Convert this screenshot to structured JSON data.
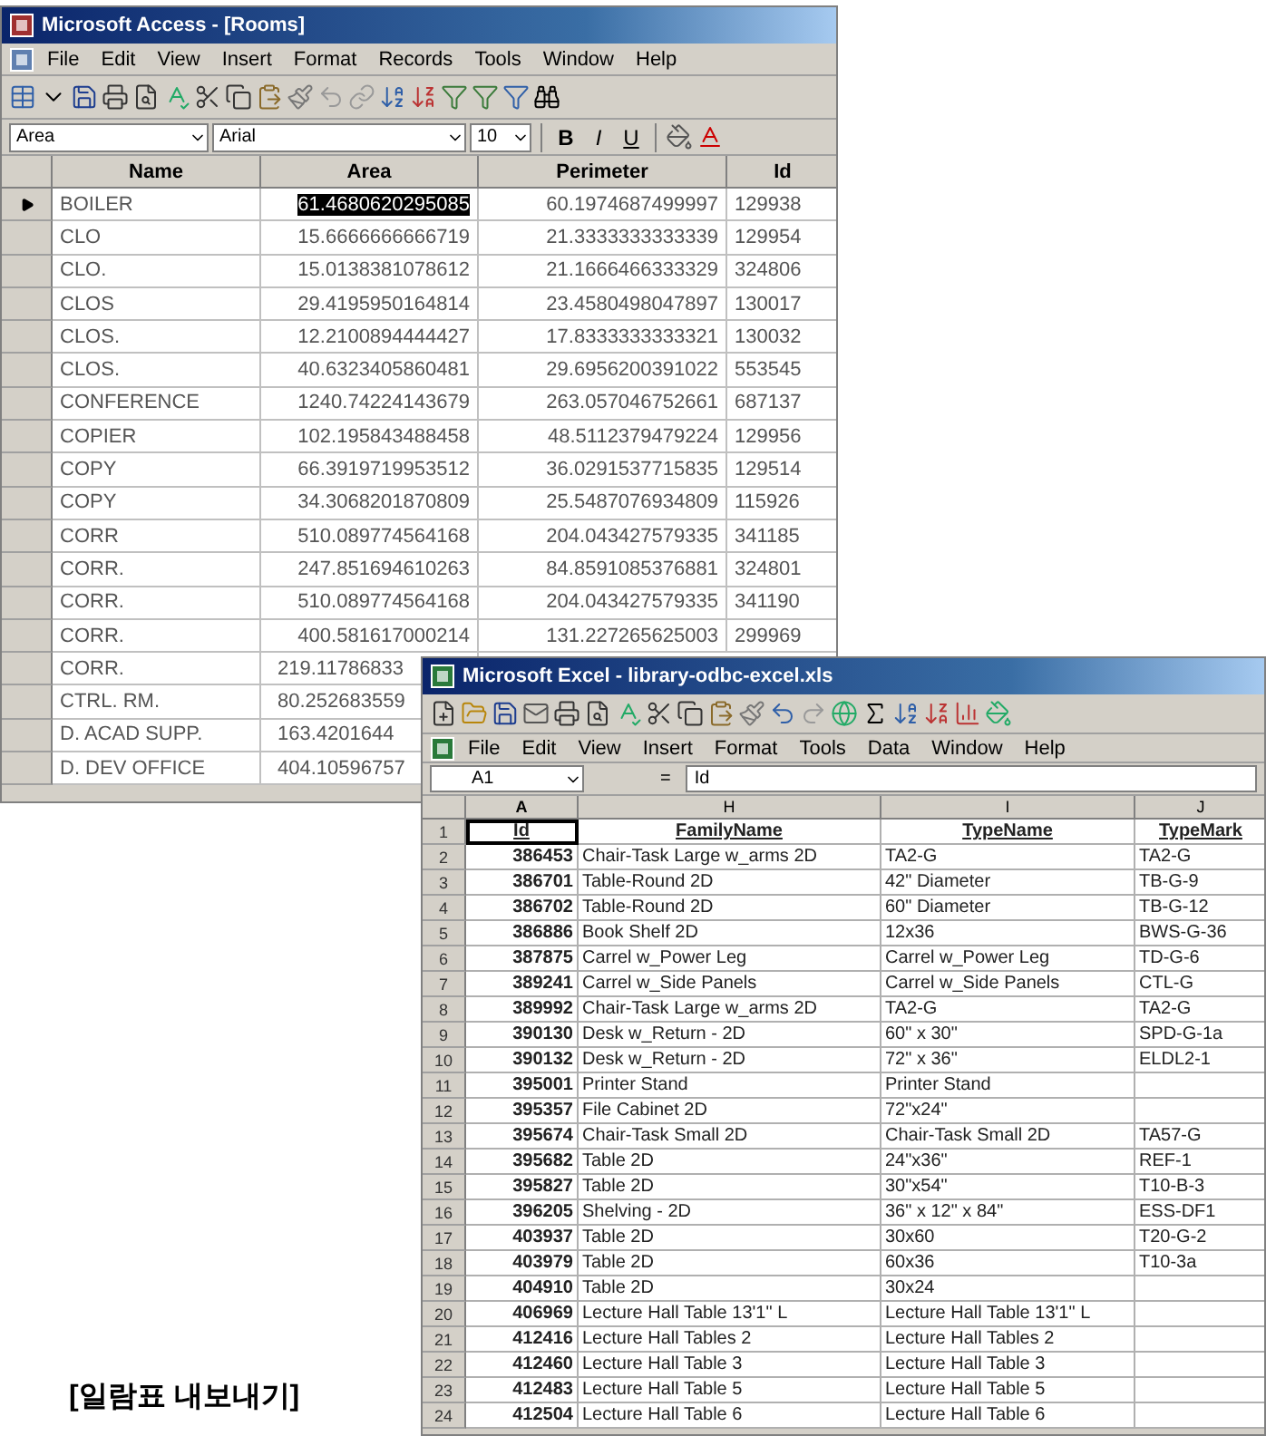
{
  "access_window": {
    "title": "Microsoft Access - [Rooms]",
    "menu": [
      "File",
      "Edit",
      "View",
      "Insert",
      "Format",
      "Records",
      "Tools",
      "Window",
      "Help"
    ],
    "format_bar": {
      "field": "Area",
      "font": "Arial",
      "size": "10",
      "styles": [
        "B",
        "I",
        "U"
      ]
    },
    "columns": [
      {
        "label": "Name",
        "selected": false
      },
      {
        "label": "Area",
        "selected": true
      },
      {
        "label": "Perimeter",
        "selected": false
      },
      {
        "label": "Id",
        "selected": false
      }
    ],
    "rows": [
      {
        "name": "BOILER",
        "area": "61.4680620295085",
        "perimeter": "60.1974687499997",
        "id": "129938",
        "selected": true
      },
      {
        "name": "CLO",
        "area": "15.6666666666719",
        "perimeter": "21.3333333333339",
        "id": "129954",
        "selected": false
      },
      {
        "name": "CLO.",
        "area": "15.0138381078612",
        "perimeter": "21.1666466333329",
        "id": "324806",
        "selected": false
      },
      {
        "name": "CLOS",
        "area": "29.4195950164814",
        "perimeter": "23.4580498047897",
        "id": "130017",
        "selected": false
      },
      {
        "name": "CLOS.",
        "area": "12.2100894444427",
        "perimeter": "17.8333333333321",
        "id": "130032",
        "selected": false
      },
      {
        "name": "CLOS.",
        "area": "40.6323405860481",
        "perimeter": "29.6956200391022",
        "id": "553545",
        "selected": false
      },
      {
        "name": "CONFERENCE",
        "area": "1240.74224143679",
        "perimeter": "263.057046752661",
        "id": "687137",
        "selected": false
      },
      {
        "name": "COPIER",
        "area": "102.195843488458",
        "perimeter": "48.5112379479224",
        "id": "129956",
        "selected": false
      },
      {
        "name": "COPY",
        "area": "66.3919719953512",
        "perimeter": "36.0291537715835",
        "id": "129514",
        "selected": false
      },
      {
        "name": "COPY",
        "area": "34.3068201870809",
        "perimeter": "25.5487076934809",
        "id": "115926",
        "selected": false
      },
      {
        "name": "CORR",
        "area": "510.089774564168",
        "perimeter": "204.043427579335",
        "id": "341185",
        "selected": false
      },
      {
        "name": "CORR.",
        "area": "247.851694610263",
        "perimeter": "84.8591085376881",
        "id": "324801",
        "selected": false
      },
      {
        "name": "CORR.",
        "area": "510.089774564168",
        "perimeter": "204.043427579335",
        "id": "341190",
        "selected": false
      },
      {
        "name": "CORR.",
        "area": "400.581617000214",
        "perimeter": "131.227265625003",
        "id": "299969",
        "selected": false
      },
      {
        "name": "CORR.",
        "area": "219.11786833",
        "selected": false
      },
      {
        "name": "CTRL. RM.",
        "area": "80.252683559",
        "selected": false
      },
      {
        "name": "D. ACAD SUPP.",
        "area": "163.4201644",
        "selected": false
      },
      {
        "name": "D. DEV OFFICE",
        "area": "404.10596757",
        "selected": false
      }
    ]
  },
  "excel_window": {
    "title": "Microsoft Excel - library-odbc-excel.xls",
    "menu": [
      "File",
      "Edit",
      "View",
      "Insert",
      "Format",
      "Tools",
      "Data",
      "Window",
      "Help"
    ],
    "name_box": "A1",
    "equals": "=",
    "formula": "Id",
    "columns": [
      {
        "letter": "A",
        "selected": true
      },
      {
        "letter": "H",
        "selected": false
      },
      {
        "letter": "I",
        "selected": false
      },
      {
        "letter": "J",
        "selected": false
      }
    ],
    "rows": [
      {
        "number": "1",
        "cells": [
          "Id",
          "FamilyName",
          "TypeName",
          "TypeMark"
        ],
        "kind": "header",
        "selected": true
      },
      {
        "number": "2",
        "cells": [
          "386453",
          "Chair-Task Large w_arms 2D",
          "TA2-G",
          "TA2-G"
        ],
        "kind": "data",
        "selected": false
      },
      {
        "number": "3",
        "cells": [
          "386701",
          "Table-Round 2D",
          "42\" Diameter",
          "TB-G-9"
        ],
        "kind": "data",
        "selected": false
      },
      {
        "number": "4",
        "cells": [
          "386702",
          "Table-Round 2D",
          "60\" Diameter",
          "TB-G-12"
        ],
        "kind": "data",
        "selected": false
      },
      {
        "number": "5",
        "cells": [
          "386886",
          "Book Shelf 2D",
          "12x36",
          "BWS-G-36"
        ],
        "kind": "data",
        "selected": false
      },
      {
        "number": "6",
        "cells": [
          "387875",
          "Carrel w_Power Leg",
          "Carrel w_Power Leg",
          "TD-G-6"
        ],
        "kind": "data",
        "selected": false
      },
      {
        "number": "7",
        "cells": [
          "389241",
          "Carrel w_Side Panels",
          "Carrel w_Side Panels",
          "CTL-G"
        ],
        "kind": "data",
        "selected": false
      },
      {
        "number": "8",
        "cells": [
          "389992",
          "Chair-Task Large w_arms 2D",
          "TA2-G",
          "TA2-G"
        ],
        "kind": "data",
        "selected": false
      },
      {
        "number": "9",
        "cells": [
          "390130",
          "Desk w_Return - 2D",
          "60\" x 30\"",
          "SPD-G-1a"
        ],
        "kind": "data",
        "selected": false
      },
      {
        "number": "10",
        "cells": [
          "390132",
          "Desk w_Return - 2D",
          "72\" x 36\"",
          "ELDL2-1"
        ],
        "kind": "data",
        "selected": false
      },
      {
        "number": "11",
        "cells": [
          "395001",
          "Printer Stand",
          "Printer Stand",
          ""
        ],
        "kind": "data",
        "selected": false
      },
      {
        "number": "12",
        "cells": [
          "395357",
          "File Cabinet 2D",
          "72\"x24\"",
          ""
        ],
        "kind": "data",
        "selected": false
      },
      {
        "number": "13",
        "cells": [
          "395674",
          "Chair-Task Small 2D",
          "Chair-Task Small 2D",
          "TA57-G"
        ],
        "kind": "data",
        "selected": false
      },
      {
        "number": "14",
        "cells": [
          "395682",
          "Table 2D",
          "24\"x36\"",
          "REF-1"
        ],
        "kind": "data",
        "selected": false
      },
      {
        "number": "15",
        "cells": [
          "395827",
          "Table 2D",
          "30\"x54\"",
          "T10-B-3"
        ],
        "kind": "data",
        "selected": false
      },
      {
        "number": "16",
        "cells": [
          "396205",
          "Shelving - 2D",
          "36\" x 12\" x 84\"",
          "ESS-DF1"
        ],
        "kind": "data",
        "selected": false
      },
      {
        "number": "17",
        "cells": [
          "403937",
          "Table 2D",
          "30x60",
          "T20-G-2"
        ],
        "kind": "data",
        "selected": false
      },
      {
        "number": "18",
        "cells": [
          "403979",
          "Table 2D",
          "60x36",
          "T10-3a"
        ],
        "kind": "data",
        "selected": false
      },
      {
        "number": "19",
        "cells": [
          "404910",
          "Table 2D",
          "30x24",
          ""
        ],
        "kind": "data",
        "selected": false
      },
      {
        "number": "20",
        "cells": [
          "406969",
          "Lecture Hall Table 13'1\" L",
          "Lecture Hall Table 13'1\" L",
          ""
        ],
        "kind": "data",
        "selected": false
      },
      {
        "number": "21",
        "cells": [
          "412416",
          "Lecture Hall Tables 2",
          "Lecture Hall Tables 2",
          ""
        ],
        "kind": "data",
        "selected": false
      },
      {
        "number": "22",
        "cells": [
          "412460",
          "Lecture Hall Table 3",
          "Lecture Hall Table 3",
          ""
        ],
        "kind": "data",
        "selected": false
      },
      {
        "number": "23",
        "cells": [
          "412483",
          "Lecture Hall Table 5",
          "Lecture Hall Table 5",
          ""
        ],
        "kind": "data",
        "selected": false
      },
      {
        "number": "24",
        "cells": [
          "412504",
          "Lecture Hall Table 6",
          "Lecture Hall Table 6",
          ""
        ],
        "kind": "data",
        "selected": false
      }
    ]
  },
  "caption": "[일람표 내보내기]"
}
